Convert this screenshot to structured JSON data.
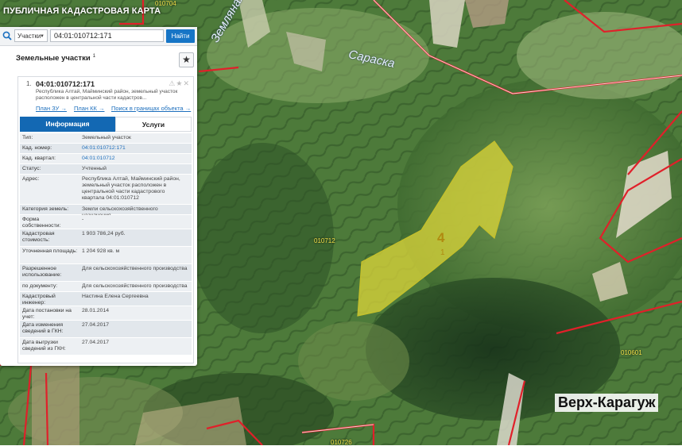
{
  "app": {
    "title": "ПУБЛИЧНАЯ КАДАСТРОВАЯ КАРТА"
  },
  "search": {
    "type_value": "Участки",
    "query": "04:01:010712:171",
    "button_label": "Найти"
  },
  "panel": {
    "section_title": "Земельные участки",
    "section_count": "1"
  },
  "card": {
    "index": "1.",
    "cadastral_number": "04:01:010712:171",
    "address_short": "Республика Алтай, Майминский район, земельный участок расположен в центральной части кадастров...",
    "links": {
      "plan_zu": "План ЗУ →",
      "plan_kk": "План КК →",
      "search_bounds": "Поиск в границах объекта →"
    },
    "tabs": {
      "info": "Информация",
      "services": "Услуги"
    },
    "properties": [
      {
        "label": "Тип:",
        "value": "Земельный участок",
        "link": false
      },
      {
        "label": "Кад. номер:",
        "value": "04:01:010712:171",
        "link": true
      },
      {
        "label": "Кад. квартал:",
        "value": "04:01:010712",
        "link": true
      },
      {
        "label": "Статус:",
        "value": "Учтенный",
        "link": false
      },
      {
        "label": "Адрес:",
        "value": "Республика Алтай, Майминский район, земельный участок расположен в центральной части кадастрового квартала 04:01:010712",
        "link": false
      },
      {
        "label": "Категория земель:",
        "value": "Земли сельскохозяйственного назначения",
        "link": false
      },
      {
        "label": "Форма собственности:",
        "value": "-",
        "link": false
      },
      {
        "label": "Кадастровая стоимость:",
        "value": "1 903 786,24 руб.",
        "link": false
      },
      {
        "label": "Уточненная площадь:",
        "value": "1 204 928 кв. м",
        "link": false
      },
      {
        "label": "Разрешенное использование:",
        "value": "Для сельскохозяйственного производства",
        "link": false
      },
      {
        "label": "по документу:",
        "value": "Для сельскохозяйственного производства",
        "link": false
      },
      {
        "label": "Кадастровый инженер:",
        "value": "Настина Елена Сергеевна",
        "link": false
      },
      {
        "label": "Дата постановки на учет:",
        "value": "28.01.2014",
        "link": false
      },
      {
        "label": "Дата изменения сведений в ГКН:",
        "value": "27.04.2017",
        "link": false
      },
      {
        "label": "Дата выгрузки сведений из ГКН:",
        "value": "27.04.2017",
        "link": false
      }
    ]
  },
  "map": {
    "labels": {
      "river_1": "Земляная",
      "river_2": "Сараска",
      "parcel_quarter": "010712",
      "parcel_big": "4",
      "parcel_small": "1",
      "quarter_right": "010601",
      "quarter_left": "01",
      "quarter_bottom": "010726",
      "quarter_top": "010704",
      "town": "Верх-Карагуж"
    },
    "colors": {
      "parcel_fill": "#d7d23a",
      "boundary": "#e0202a",
      "panel_tab": "#1368b3",
      "button": "#1775c6"
    }
  }
}
